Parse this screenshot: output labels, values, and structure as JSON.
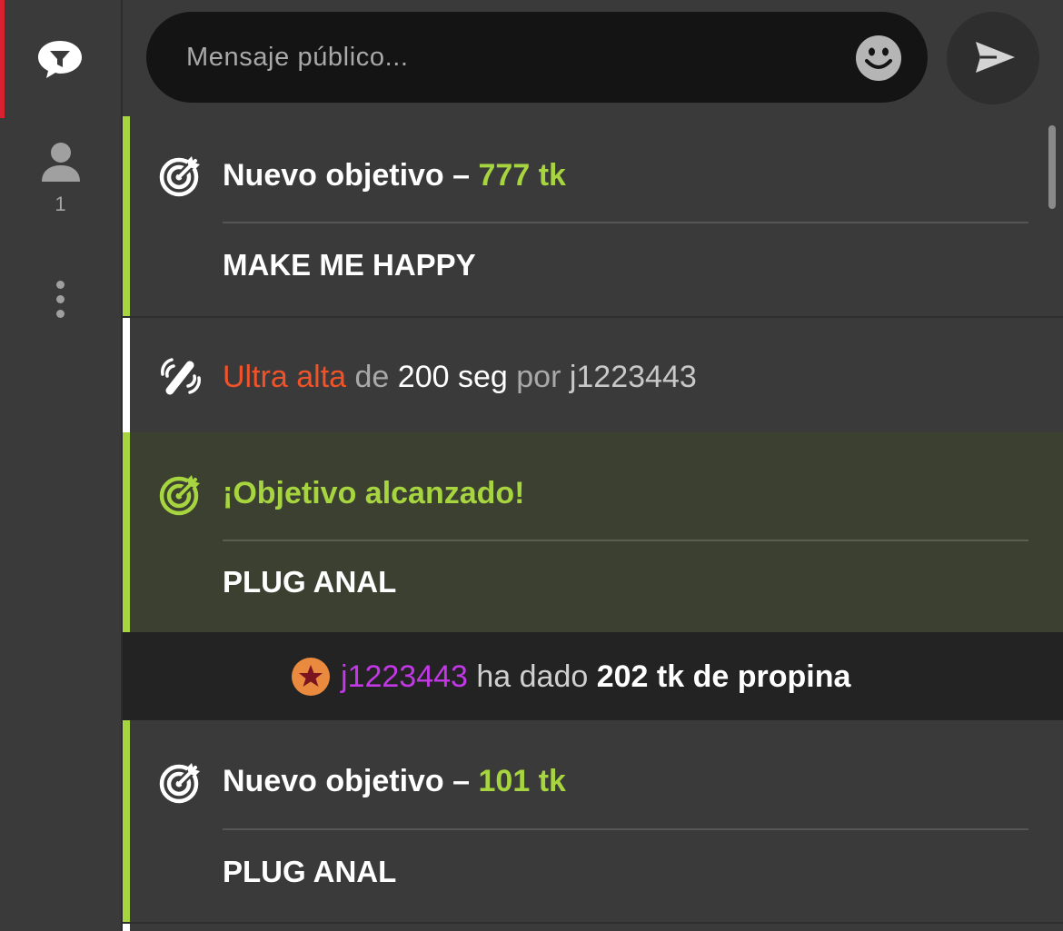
{
  "sidebar": {
    "chat_icon": "chat-bubble-icon",
    "users_icon": "user-icon",
    "users_count": "1",
    "more_icon": "more-vertical-icon"
  },
  "composer": {
    "placeholder": "Mensaje público...",
    "emoji_icon": "smiley-icon",
    "send_icon": "send-icon"
  },
  "feed": {
    "goal1": {
      "icon": "target-icon",
      "title_prefix": "Nuevo objetivo –",
      "amount": "777 tk",
      "goal_name": "MAKE ME HAPPY"
    },
    "vibe": {
      "icon": "vibration-icon",
      "level": "Ultra alta",
      "de": "de",
      "duration": "200 seg",
      "por": "por",
      "user": "j1223443"
    },
    "reached": {
      "icon": "target-icon",
      "title": "¡Objetivo alcanzado!",
      "goal_name": "PLUG ANAL"
    },
    "tip": {
      "icon": "star-badge-icon",
      "user": "j1223443",
      "action": "ha dado",
      "amount": "202 tk de propina"
    },
    "goal2": {
      "icon": "target-icon",
      "title_prefix": "Nuevo objetivo –",
      "amount": "101 tk",
      "goal_name": "PLUG ANAL"
    }
  },
  "colors": {
    "accent_green": "#a7d53f",
    "accent_red": "#d8222f",
    "ultra_orange": "#f0532a",
    "username_purple": "#c238e6",
    "tip_badge_orange": "#e98a3e"
  }
}
